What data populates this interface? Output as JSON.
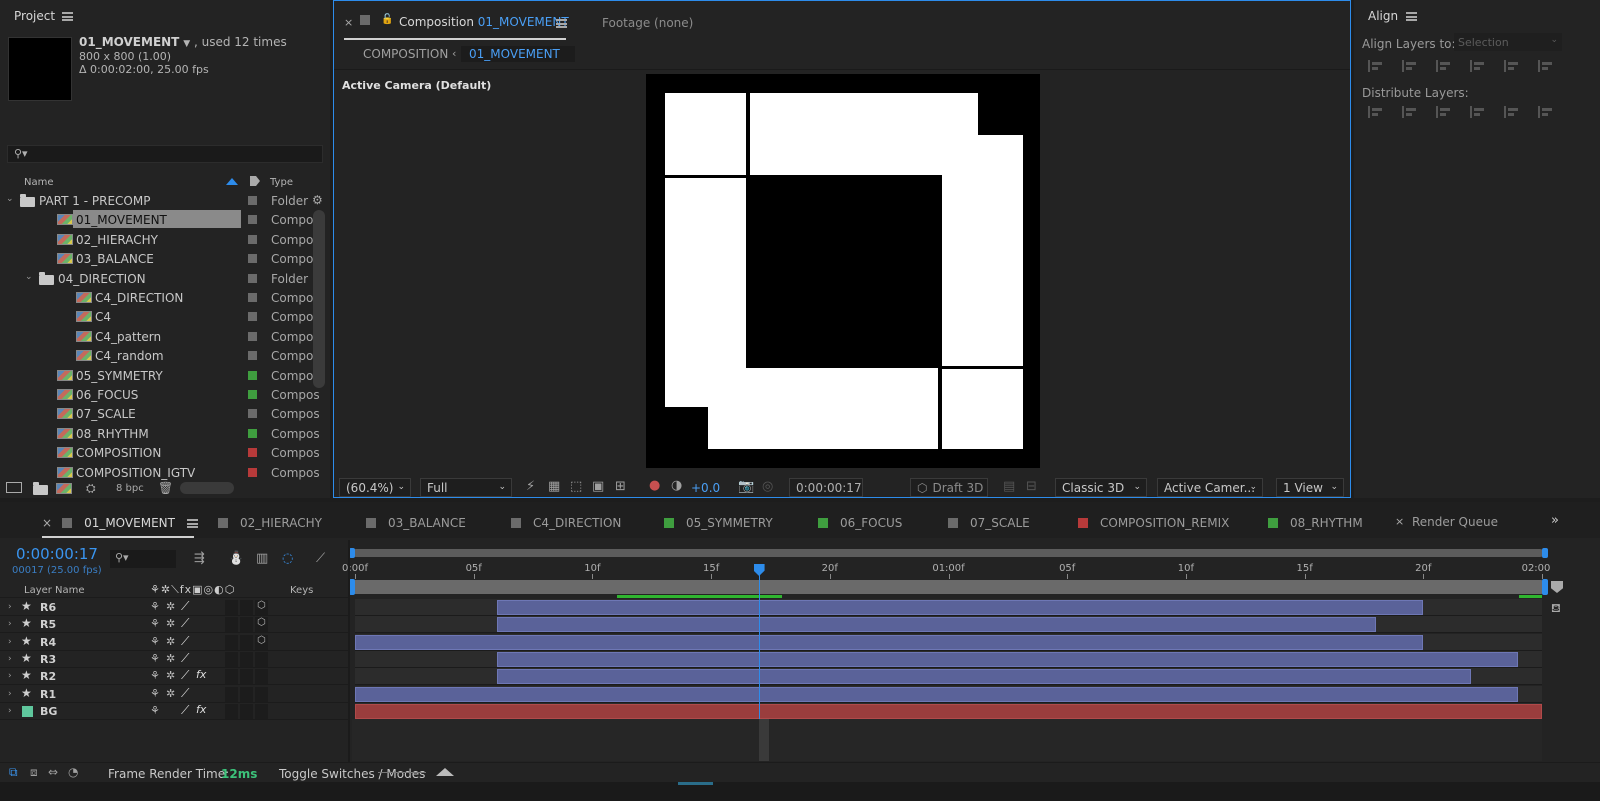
{
  "project": {
    "title": "Project",
    "comp_name": "01_MOVEMENT",
    "usage": ", used 12 times",
    "dimensions": "800 x 800 (1.00)",
    "duration": "Δ 0:00:02:00, 25.00 fps",
    "col_name": "Name",
    "col_type": "Type",
    "items": [
      {
        "name": "PART 1 - PRECOMP",
        "type": "Folder",
        "kind": "folder",
        "level": 0,
        "expanded": true,
        "label": "#6b6b6b"
      },
      {
        "name": "01_MOVEMENT",
        "type": "Compos",
        "kind": "comp",
        "level": 1,
        "selected": true,
        "label": "#6b6b6b"
      },
      {
        "name": "02_HIERACHY",
        "type": "Compos",
        "kind": "comp",
        "level": 1,
        "label": "#6b6b6b"
      },
      {
        "name": "03_BALANCE",
        "type": "Compos",
        "kind": "comp",
        "level": 1,
        "label": "#6b6b6b"
      },
      {
        "name": "04_DIRECTION",
        "type": "Folder",
        "kind": "folder",
        "level": 1,
        "expanded": true,
        "label": "#6b6b6b"
      },
      {
        "name": "C4_DIRECTION",
        "type": "Compos",
        "kind": "comp",
        "level": 2,
        "label": "#6b6b6b"
      },
      {
        "name": "C4",
        "type": "Compos",
        "kind": "comp",
        "level": 2,
        "label": "#6b6b6b"
      },
      {
        "name": "C4_pattern",
        "type": "Compos",
        "kind": "comp",
        "level": 2,
        "label": "#6b6b6b"
      },
      {
        "name": "C4_random",
        "type": "Compos",
        "kind": "comp",
        "level": 2,
        "label": "#6b6b6b"
      },
      {
        "name": "05_SYMMETRY",
        "type": "Compos",
        "kind": "comp",
        "level": 1,
        "label": "#3f9e3f"
      },
      {
        "name": "06_FOCUS",
        "type": "Compos",
        "kind": "comp",
        "level": 1,
        "label": "#3f9e3f"
      },
      {
        "name": "07_SCALE",
        "type": "Compos",
        "kind": "comp",
        "level": 1,
        "label": "#6b6b6b"
      },
      {
        "name": "08_RHYTHM",
        "type": "Compos",
        "kind": "comp",
        "level": 1,
        "label": "#3f9e3f"
      },
      {
        "name": "COMPOSITION",
        "type": "Compos",
        "kind": "comp",
        "level": 1,
        "label": "#b73a3a"
      },
      {
        "name": "COMPOSITION_IGTV",
        "type": "Compos",
        "kind": "comp",
        "level": 1,
        "label": "#b73a3a"
      }
    ],
    "bpc": "8 bpc"
  },
  "composition": {
    "tab_label": "Composition",
    "tab_comp": "01_MOVEMENT",
    "footage_tab": "Footage  (none)",
    "crumb_root": "COMPOSITION",
    "crumb_current": "01_MOVEMENT",
    "camera_label": "Active Camera (Default)",
    "zoom": "(60.4%)",
    "resolution": "Full",
    "exposure": "+0.0",
    "timecode": "0:00:00:17",
    "draft3d": "Draft 3D",
    "renderer": "Classic 3D",
    "camera": "Active Camer...",
    "views": "1 View"
  },
  "align": {
    "title": "Align",
    "align_layers_to": "Align Layers to:",
    "selection": "Selection",
    "distribute_layers": "Distribute Layers:"
  },
  "timeline": {
    "tabs": [
      {
        "label": "01_MOVEMENT",
        "color": "#6b6b6b",
        "active": true
      },
      {
        "label": "02_HIERACHY",
        "color": "#6b6b6b"
      },
      {
        "label": "03_BALANCE",
        "color": "#6b6b6b"
      },
      {
        "label": "C4_DIRECTION",
        "color": "#6b6b6b"
      },
      {
        "label": "05_SYMMETRY",
        "color": "#3f9e3f"
      },
      {
        "label": "06_FOCUS",
        "color": "#3f9e3f"
      },
      {
        "label": "07_SCALE",
        "color": "#6b6b6b"
      },
      {
        "label": "COMPOSITION_REMIX",
        "color": "#b73a3a"
      },
      {
        "label": "08_RHYTHM",
        "color": "#3f9e3f"
      }
    ],
    "render_queue": "Render Queue",
    "current_time": "0:00:00:17",
    "frame_info": "00017 (25.00 fps)",
    "col_layer_name": "Layer Name",
    "col_keys": "Keys",
    "ruler_labels": [
      "0:00f",
      "05f",
      "10f",
      "15f",
      "20f",
      "01:00f",
      "05f",
      "10f",
      "15f",
      "20f",
      "02:00"
    ],
    "total_frames": 50,
    "playhead_frame": 17,
    "layers": [
      {
        "name": "R6",
        "icon": "star",
        "fx": false,
        "cube": true,
        "color": "#5a6299",
        "in": 6,
        "out": 45
      },
      {
        "name": "R5",
        "icon": "star",
        "fx": false,
        "cube": true,
        "color": "#5a6299",
        "in": 6,
        "out": 43
      },
      {
        "name": "R4",
        "icon": "star",
        "fx": false,
        "cube": true,
        "color": "#5a6299",
        "in": 0,
        "out": 45
      },
      {
        "name": "R3",
        "icon": "star",
        "fx": false,
        "cube": false,
        "color": "#5a6299",
        "in": 6,
        "out": 49
      },
      {
        "name": "R2",
        "icon": "star",
        "fx": true,
        "cube": false,
        "color": "#5a6299",
        "in": 6,
        "out": 47
      },
      {
        "name": "R1",
        "icon": "star",
        "fx": false,
        "cube": false,
        "color": "#5a6299",
        "in": 0,
        "out": 49
      },
      {
        "name": "BG",
        "icon": "solid",
        "fx": true,
        "cube": false,
        "color": "#9a3d3d",
        "in": 0,
        "out": 50
      }
    ],
    "frame_render_label": "Frame Render Time:",
    "frame_render_value": "12ms",
    "toggle_label": "Toggle Switches / Modes"
  }
}
